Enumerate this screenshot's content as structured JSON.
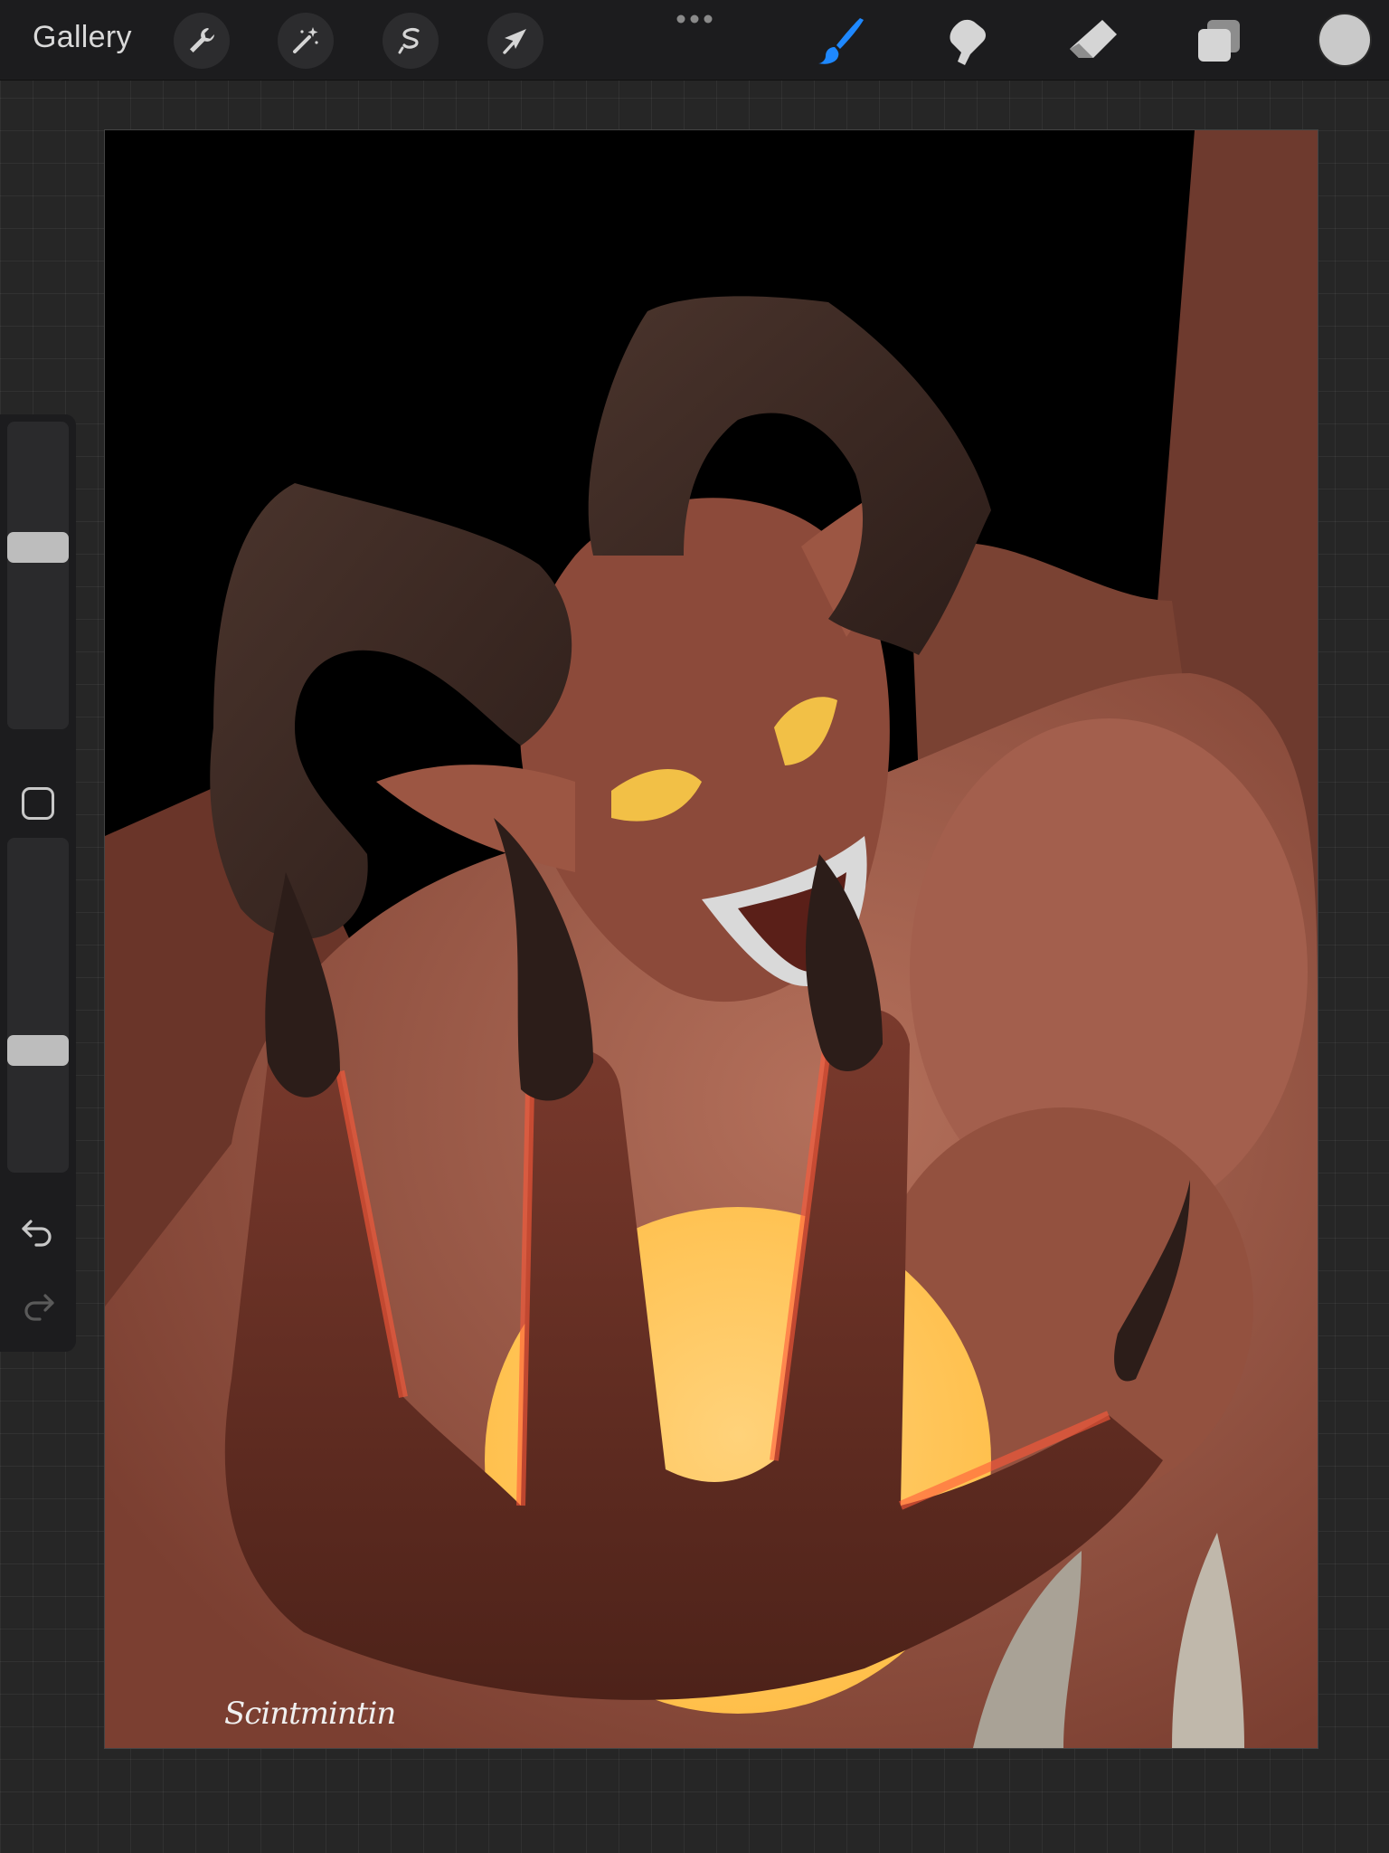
{
  "toolbar": {
    "gallery_label": "Gallery",
    "left_tools": [
      "wrench-icon",
      "magic-wand-icon",
      "selection-icon",
      "transform-arrow-icon"
    ],
    "right_tools": [
      "brush-icon",
      "smudge-icon",
      "eraser-icon",
      "layers-icon"
    ],
    "active_tool": "brush-icon",
    "active_color": "#c9c9c9",
    "accent_color": "#1e88ff"
  },
  "sidebar": {
    "brush_size_level": 0.6,
    "opacity_level": 0.35,
    "controls": [
      "brush-size-slider",
      "modify-button",
      "opacity-slider",
      "undo-icon",
      "redo-icon"
    ]
  },
  "artwork": {
    "subject": "red horned demon with glowing sun behind claws",
    "signature": "Scintmintin",
    "palette": {
      "background": "#000000",
      "skin": "#8e4d3c",
      "skin_light": "#b16a56",
      "horns": "#3b2721",
      "eyes": "#f2c046",
      "sun": "#ffc85a",
      "glow": "#ff5a3a"
    }
  }
}
